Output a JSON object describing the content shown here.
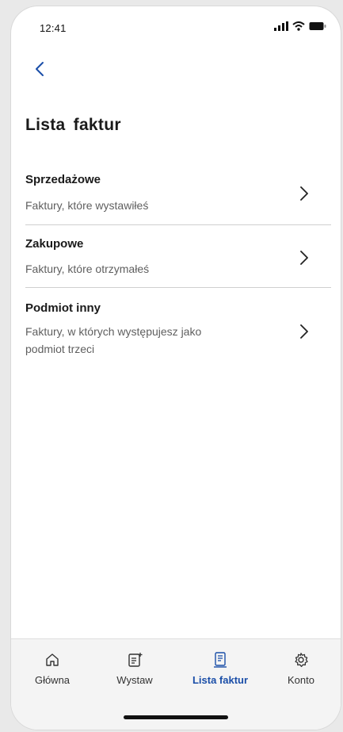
{
  "status_bar": {
    "time": "12:41",
    "icons": [
      "signal-icon",
      "wifi-icon",
      "battery-icon"
    ]
  },
  "header": {
    "back_icon": "chevron-left-icon",
    "title": "Lista  faktur"
  },
  "list": {
    "items": [
      {
        "title": "Sprzedażowe",
        "subtitle": "Faktury, które wystawiłeś",
        "icon": "chevron-right-icon"
      },
      {
        "title": "Zakupowe",
        "subtitle": "Faktury, które otrzymałeś",
        "icon": "chevron-right-icon"
      },
      {
        "title": "Podmiot inny",
        "subtitle": "Faktury, w których występujesz jako podmiot trzeci",
        "icon": "chevron-right-icon"
      }
    ]
  },
  "bottom_nav": {
    "items": [
      {
        "label": "Główna",
        "icon": "home-icon",
        "active": false
      },
      {
        "label": "Wystaw",
        "icon": "new-document-icon",
        "active": false
      },
      {
        "label": "Lista faktur",
        "icon": "invoice-list-icon",
        "active": true
      },
      {
        "label": "Konto",
        "icon": "gear-icon",
        "active": false
      }
    ]
  },
  "colors": {
    "accent": "#1a4ea8",
    "text_primary": "#1a1a1a",
    "text_secondary": "#5f5f5f",
    "divider": "#cfcfcf",
    "nav_background": "#f4f4f4"
  }
}
